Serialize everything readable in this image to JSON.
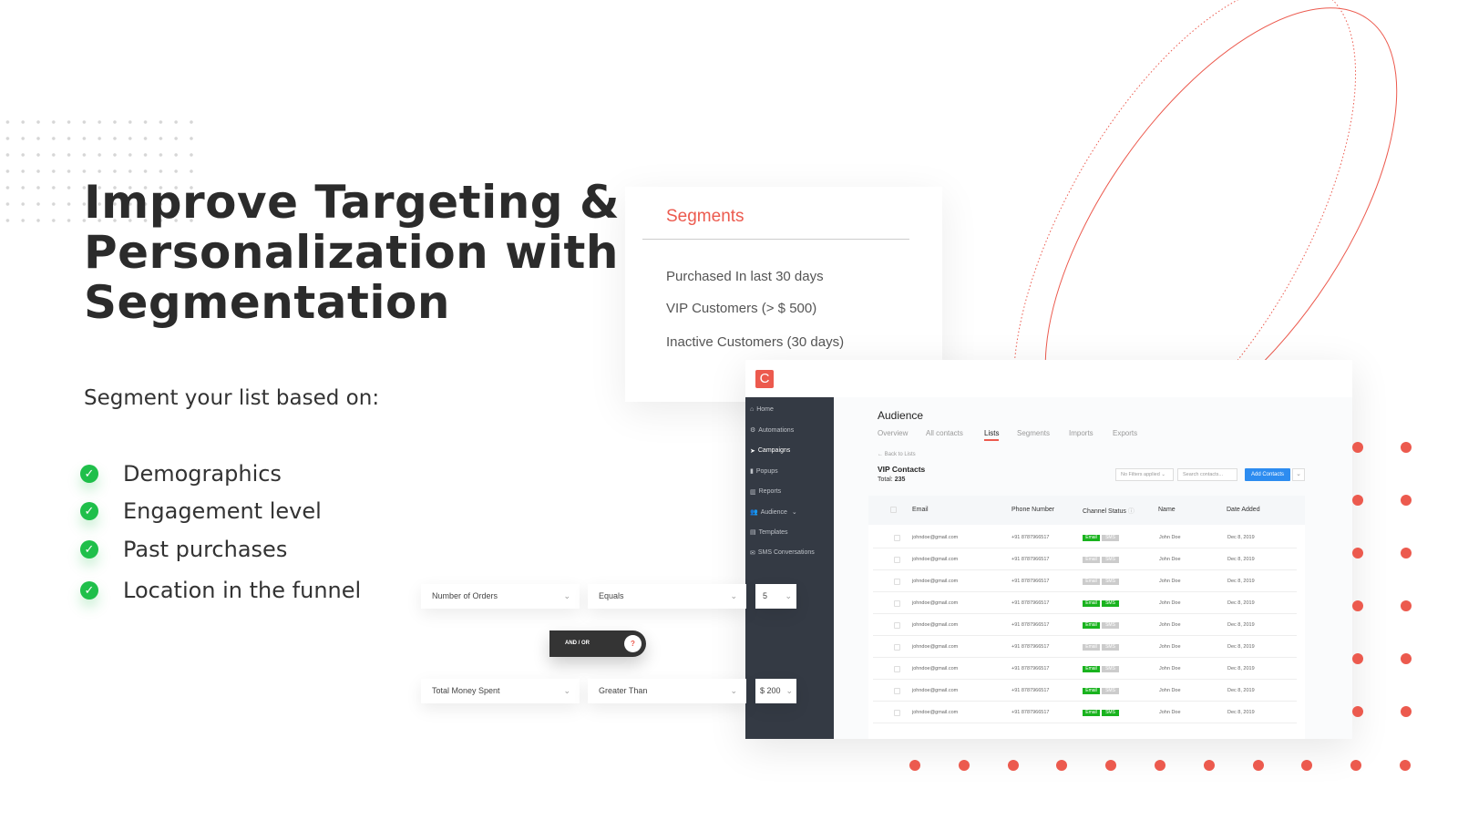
{
  "hero": {
    "title": "Improve Targeting & Personalization with Segmentation",
    "subtitle": "Segment your list based on:",
    "features": [
      "Demographics",
      "Engagement level",
      "Past purchases",
      "Location in the funnel"
    ]
  },
  "segments_card": {
    "title": "Segments",
    "items": [
      "Purchased In last 30 days",
      "VIP Customers (> $ 500)",
      "Inactive Customers (30 days)"
    ]
  },
  "app": {
    "logo_letter": "C",
    "sidebar": [
      {
        "label": "Home",
        "icon": "home-icon"
      },
      {
        "label": "Automations",
        "icon": "gears-icon"
      },
      {
        "label": "Campaigns",
        "icon": "paper-plane-icon",
        "active": true
      },
      {
        "label": "Popups",
        "icon": "popup-icon"
      },
      {
        "label": "Reports",
        "icon": "chart-icon"
      },
      {
        "label": "Audience",
        "icon": "users-icon"
      },
      {
        "label": "Templates",
        "icon": "template-icon"
      },
      {
        "label": "SMS Conversations",
        "icon": "chat-icon"
      }
    ],
    "title": "Audience",
    "tabs": [
      "Overview",
      "All contacts",
      "Lists",
      "Segments",
      "Imports",
      "Exports"
    ],
    "active_tab": "Lists",
    "back_link": "Back to Lists",
    "list_name": "VIP Contacts",
    "total_label": "Total:",
    "total_value": "235",
    "filter": "No Filters applied",
    "search_placeholder": "Search contacts...",
    "add_button": "Add Contacts",
    "columns": [
      "Email",
      "Phone Number",
      "Channel Status",
      "Name",
      "Date Added"
    ],
    "badge_email": "Email",
    "badge_sms": "SMS",
    "rows": [
      {
        "email": "johndoe@gmail.com",
        "phone": "+91 8787966517",
        "email_on": true,
        "sms_on": false,
        "name": "John Doe",
        "date": "Dec 8, 2019"
      },
      {
        "email": "johndoe@gmail.com",
        "phone": "+91 8787966517",
        "email_on": false,
        "sms_on": false,
        "name": "John Doe",
        "date": "Dec 8, 2019"
      },
      {
        "email": "johndoe@gmail.com",
        "phone": "+91 8787966517",
        "email_on": false,
        "sms_on": false,
        "name": "John Doe",
        "date": "Dec 8, 2019"
      },
      {
        "email": "johndoe@gmail.com",
        "phone": "+91 8787966517",
        "email_on": true,
        "sms_on": true,
        "name": "John Doe",
        "date": "Dec 8, 2019"
      },
      {
        "email": "johndoe@gmail.com",
        "phone": "+91 8787966517",
        "email_on": true,
        "sms_on": false,
        "name": "John Doe",
        "date": "Dec 8, 2019"
      },
      {
        "email": "johndoe@gmail.com",
        "phone": "+91 8787966517",
        "email_on": false,
        "sms_on": false,
        "name": "John Doe",
        "date": "Dec 8, 2019"
      },
      {
        "email": "johndoe@gmail.com",
        "phone": "+91 8787966517",
        "email_on": true,
        "sms_on": false,
        "name": "John Doe",
        "date": "Dec 8, 2019"
      },
      {
        "email": "johndoe@gmail.com",
        "phone": "+91 8787966517",
        "email_on": true,
        "sms_on": false,
        "name": "John Doe",
        "date": "Dec 8, 2019"
      },
      {
        "email": "johndoe@gmail.com",
        "phone": "+91 8787966517",
        "email_on": true,
        "sms_on": true,
        "name": "John Doe",
        "date": "Dec 8, 2019"
      }
    ]
  },
  "rules": [
    {
      "field": "Number of Orders",
      "operator": "Equals",
      "value": "5"
    },
    {
      "field": "Total Money Spent",
      "operator": "Greater Than",
      "value": "$ 200"
    }
  ],
  "connector": "AND / OR",
  "colors": {
    "accent": "#ec5a4e",
    "check": "#1fbf4a",
    "sidebar": "#343a44",
    "badge_on": "#19b31e",
    "primary": "#2d8cf0"
  }
}
